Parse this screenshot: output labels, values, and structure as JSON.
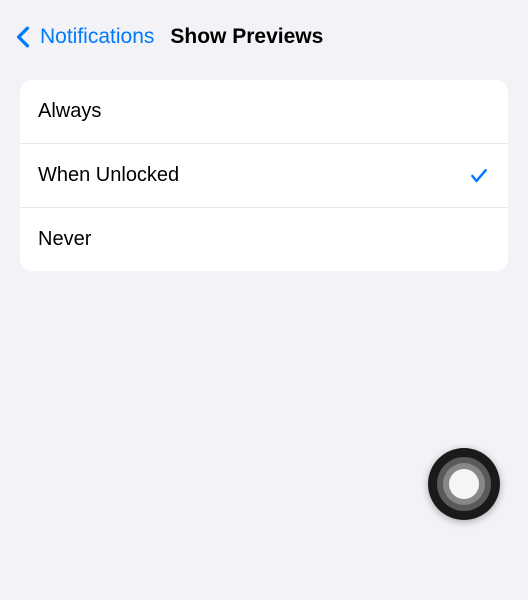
{
  "colors": {
    "accent": "#007aff",
    "background": "#f2f2f7",
    "card": "#ffffff",
    "text": "#000000",
    "separator": "#e5e5ea"
  },
  "nav": {
    "back_label": "Notifications",
    "title": "Show Previews"
  },
  "options": [
    {
      "label": "Always",
      "selected": false
    },
    {
      "label": "When Unlocked",
      "selected": true
    },
    {
      "label": "Never",
      "selected": false
    }
  ]
}
